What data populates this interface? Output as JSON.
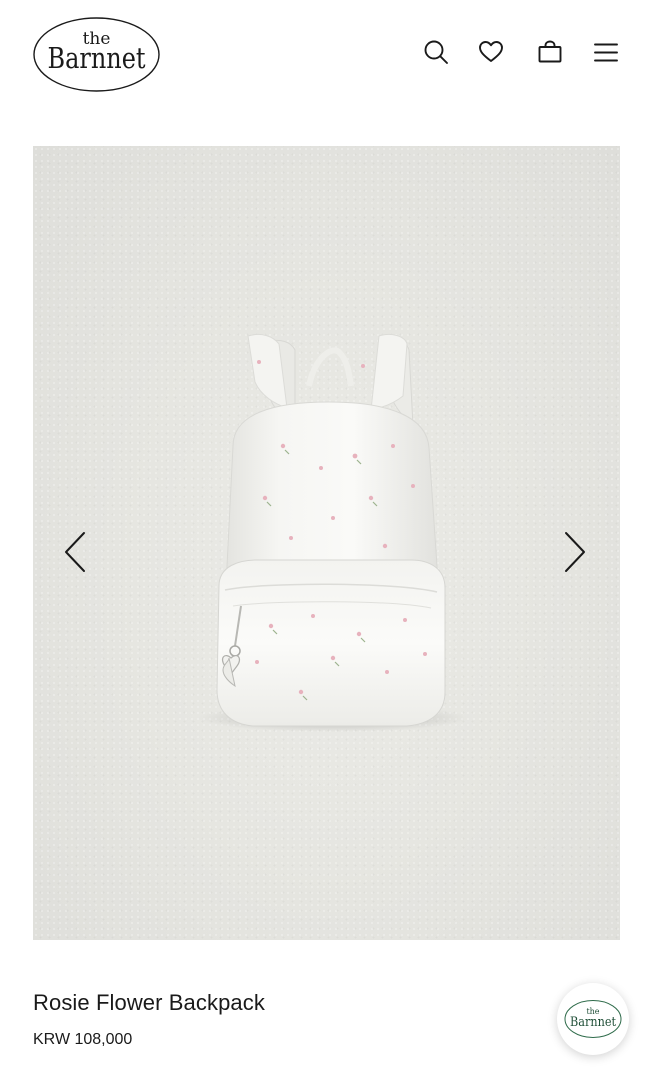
{
  "brand": {
    "logo_top": "the",
    "logo_main": "Barnnet"
  },
  "header": {
    "icons": [
      "search-icon",
      "heart-icon",
      "bag-icon",
      "menu-icon"
    ]
  },
  "gallery": {
    "prev_icon": "chevron-left-icon",
    "next_icon": "chevron-right-icon"
  },
  "product": {
    "name": "Rosie Flower Backpack",
    "price": "KRW 108,000"
  },
  "fab": {
    "logo_top": "the",
    "logo_main": "Barnnet"
  },
  "colors": {
    "text": "#1a1a1a",
    "image_bg": "#e6e6e1",
    "fab_logo": "#1f4f37"
  }
}
